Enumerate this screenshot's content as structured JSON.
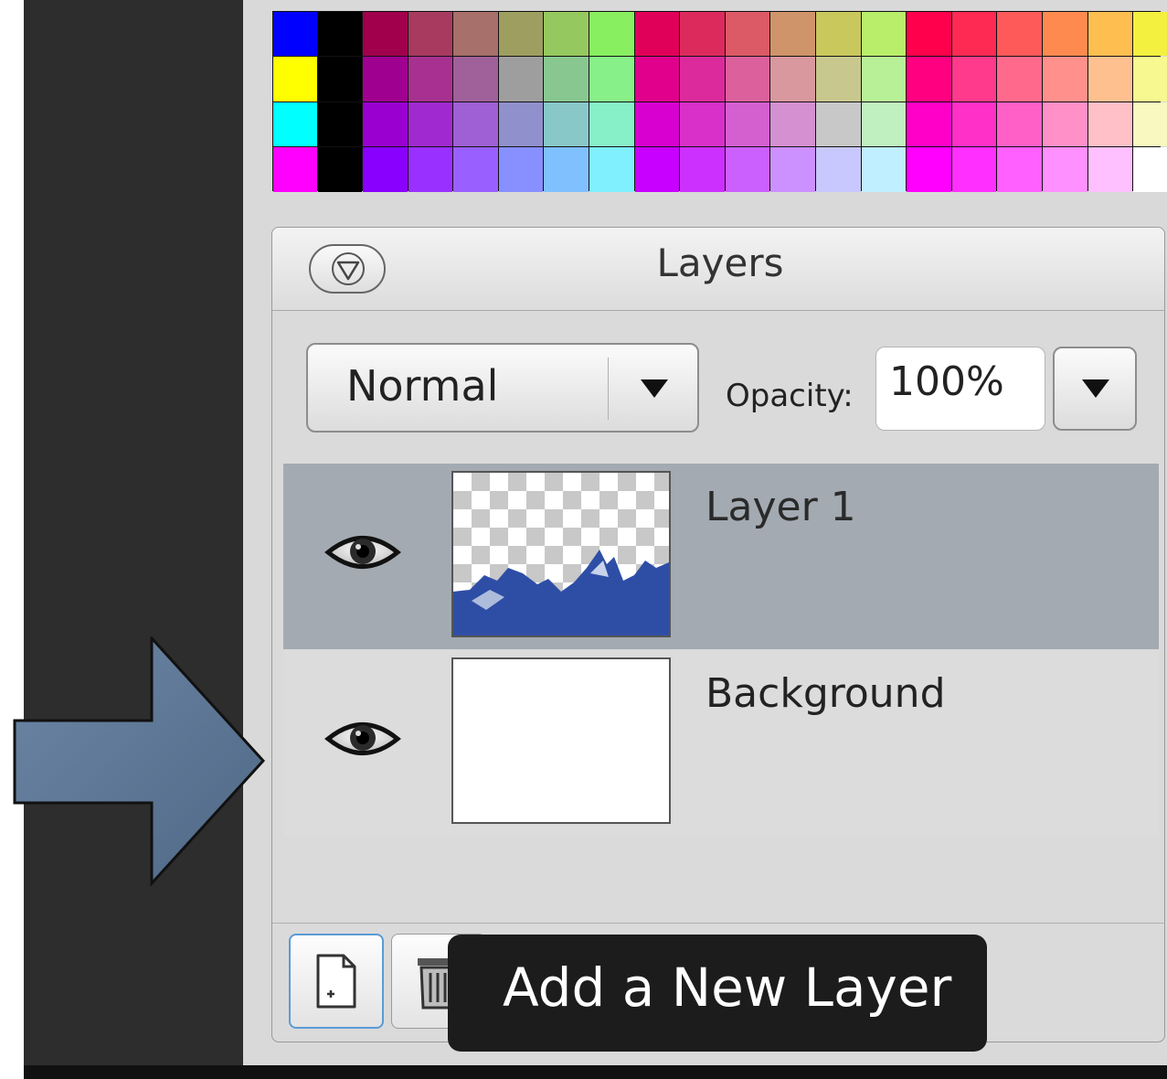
{
  "swatches": {
    "colors": [
      "#0000ff",
      "#000000",
      "#a0004c",
      "#a83a60",
      "#a8706a",
      "#9e9e60",
      "#96c860",
      "#88f060",
      "#e0005a",
      "#dc2a5c",
      "#dc5a66",
      "#d0946a",
      "#c8c85c",
      "#b8ee6a",
      "#ff004c",
      "#ff2a54",
      "#ff5a5a",
      "#ff8a50",
      "#ffbe50",
      "#f4f040",
      "#ffff00",
      "#000000",
      "#a00090",
      "#a83090",
      "#a0609a",
      "#9e9e9e",
      "#88c890",
      "#88f088",
      "#e0008c",
      "#dc2a9c",
      "#dc609c",
      "#d8989e",
      "#c8c88e",
      "#b8f098",
      "#ff0080",
      "#ff3a8c",
      "#ff6a8c",
      "#ff908c",
      "#ffc090",
      "#f8f890",
      "#00ffff",
      "#000000",
      "#9a00d0",
      "#a02ad0",
      "#9e60d4",
      "#9090cc",
      "#88c8c8",
      "#88f0c8",
      "#d800d0",
      "#d830c8",
      "#d460d0",
      "#d490d0",
      "#c8c8c8",
      "#c0f0c0",
      "#ff00c8",
      "#ff30c8",
      "#ff60c8",
      "#ff90c8",
      "#ffc0c8",
      "#f8f8c0",
      "#ff00ff",
      "#000000",
      "#8a00ff",
      "#9a30ff",
      "#9a60ff",
      "#8890ff",
      "#80c0ff",
      "#80f0ff",
      "#c800ff",
      "#cc30ff",
      "#cc60ff",
      "#cc90ff",
      "#c8c8ff",
      "#c0f0ff",
      "#ff00ff",
      "#ff30ff",
      "#ff60ff",
      "#ff90ff",
      "#ffc0ff",
      "#ffffff"
    ]
  },
  "layers_panel": {
    "title": "Layers",
    "collapse_icon": "collapse-triangle-icon",
    "blend_mode": "Normal",
    "opacity_label": "Opacity:",
    "opacity_value": "100%",
    "layers": [
      {
        "name": "Layer 1",
        "visible": true,
        "selected": true,
        "thumbnail": "transparent-with-blue-shape"
      },
      {
        "name": "Background",
        "visible": true,
        "selected": false,
        "thumbnail": "white"
      }
    ],
    "footer": {
      "new_layer_icon": "new-page-icon",
      "delete_layer_icon": "trash-icon"
    }
  },
  "tooltip": {
    "text": "Add a New Layer"
  },
  "annotation": {
    "pointer_color": "#5c7696"
  },
  "colors": {
    "selected_row": "#a3aab2",
    "panel_bg": "#dadada",
    "dark_workspace": "#2d2d2d"
  }
}
